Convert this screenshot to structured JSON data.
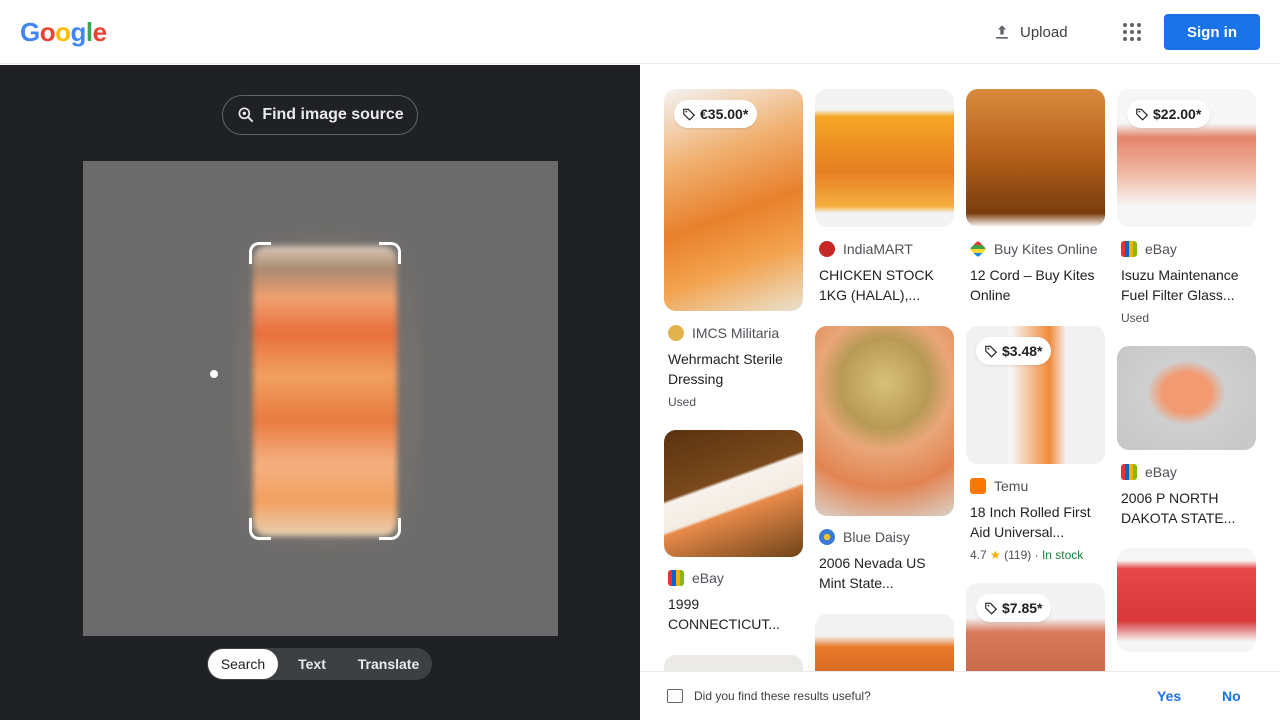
{
  "header": {
    "logo": {
      "letters": [
        "G",
        "o",
        "o",
        "g",
        "l",
        "e"
      ],
      "colors": [
        "#4285F4",
        "#EA4335",
        "#FBBC05",
        "#4285F4",
        "#34A853",
        "#EA4335"
      ]
    },
    "upload_label": "Upload",
    "signin_label": "Sign in"
  },
  "lens": {
    "find_source_label": "Find image source",
    "modes": [
      "Search",
      "Text",
      "Translate"
    ],
    "active_mode": "Search"
  },
  "results": [
    {
      "price": "€35.00*",
      "source": "IMCS Militaria",
      "title": "Wehrmacht Sterile Dressing",
      "sub": "Used"
    },
    {
      "source": "eBay",
      "title": "1999 CONNECTICUT..."
    },
    {
      "source": "IndiaMART",
      "title": "CHICKEN STOCK 1KG (HALAL),..."
    },
    {
      "source": "Blue Daisy",
      "title": "2006 Nevada US Mint State..."
    },
    {
      "source": "Buy Kites Online",
      "title": "12 Cord – Buy Kites Online"
    },
    {
      "price": "$3.48*",
      "source": "Temu",
      "title": "18 Inch Rolled First Aid Universal...",
      "rating": "4.7",
      "reviews": "(119)",
      "stock": "In stock"
    },
    {
      "price": "$7.85*"
    },
    {
      "price": "$22.00*",
      "source": "eBay",
      "title": "Isuzu Maintenance Fuel Filter Glass...",
      "sub": "Used"
    },
    {
      "source": "eBay",
      "title": "2006 P NORTH DAKOTA STATE..."
    }
  ],
  "feedback": {
    "question": "Did you find these results useful?",
    "yes": "Yes",
    "no": "No"
  }
}
